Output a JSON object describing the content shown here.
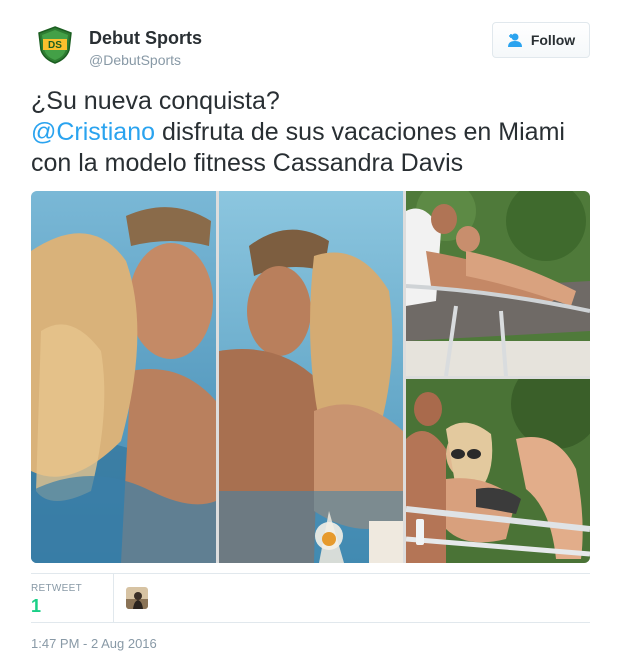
{
  "account": {
    "name": "Debut Sports",
    "handle": "@DebutSports",
    "logo_text": "DS"
  },
  "follow": {
    "label": "Follow",
    "icon": "add-user-icon"
  },
  "tweet": {
    "line1": "¿Su nueva conquista?",
    "mention": "@Cristiano",
    "line2_rest": " disfruta de sus vacaciones en Miami",
    "line3": "con la modelo fitness Cassandra Davis"
  },
  "stats": {
    "retweet_label": "RETWEET",
    "retweet_count": "1"
  },
  "timestamp": "1:47 PM - 2 Aug 2016",
  "colors": {
    "mention": "#2aa3ef",
    "retweet": "#19cf86",
    "muted": "#8899a6",
    "logo": "#2e7d32"
  }
}
